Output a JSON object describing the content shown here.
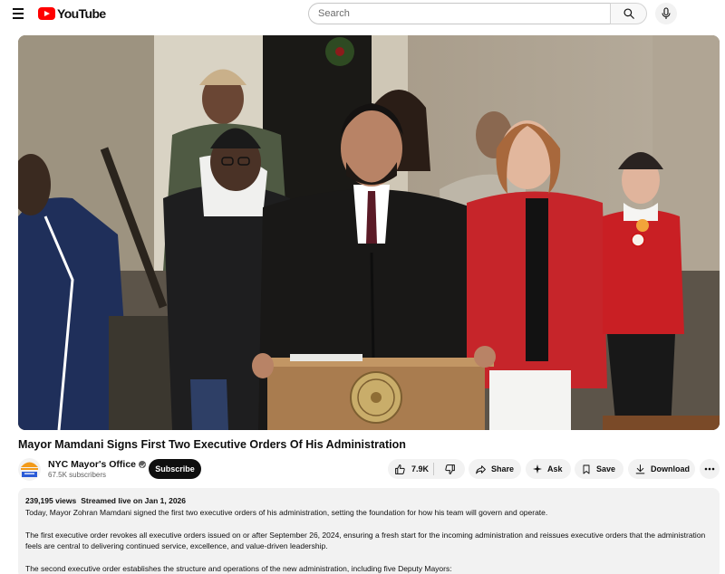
{
  "header": {
    "logo_text": "YouTube",
    "search_placeholder": "Search"
  },
  "video": {
    "title": "Mayor Mamdani Signs First Two Executive Orders Of His Administration"
  },
  "channel": {
    "name": "NYC Mayor's Office",
    "subscribers": "67.5K subscribers",
    "subscribe_label": "Subscribe"
  },
  "actions": {
    "like_count": "7.9K",
    "share_label": "Share",
    "ask_label": "Ask",
    "save_label": "Save",
    "download_label": "Download"
  },
  "description": {
    "views": "239,195 views",
    "streamed": "Streamed live on Jan 1, 2026",
    "paragraphs": [
      "Today, Mayor Zohran Mamdani signed the first two executive orders of his administration, setting the foundation for how his team will govern and operate.",
      "The first executive order revokes all executive orders issued on or after September 26, 2024, ensuring a fresh start for the incoming administration and reissues executive orders that the administration feels are central to delivering continued service, excellence, and value-driven leadership.",
      "The second executive order establishes the structure and operations of the new administration, including five Deputy Mayors:"
    ]
  },
  "colors": {
    "brand_red": "#ff0000",
    "subscribe_bg": "#0f0f0f",
    "pill_bg": "#f2f2f2",
    "text_secondary": "#606060"
  },
  "icons": [
    "menu-icon",
    "youtube-logo-icon",
    "search-icon",
    "mic-icon",
    "verified-icon",
    "thumbs-up-icon",
    "thumbs-down-icon",
    "share-icon",
    "sparkle-icon",
    "bookmark-icon",
    "download-icon",
    "more-horizontal-icon"
  ]
}
